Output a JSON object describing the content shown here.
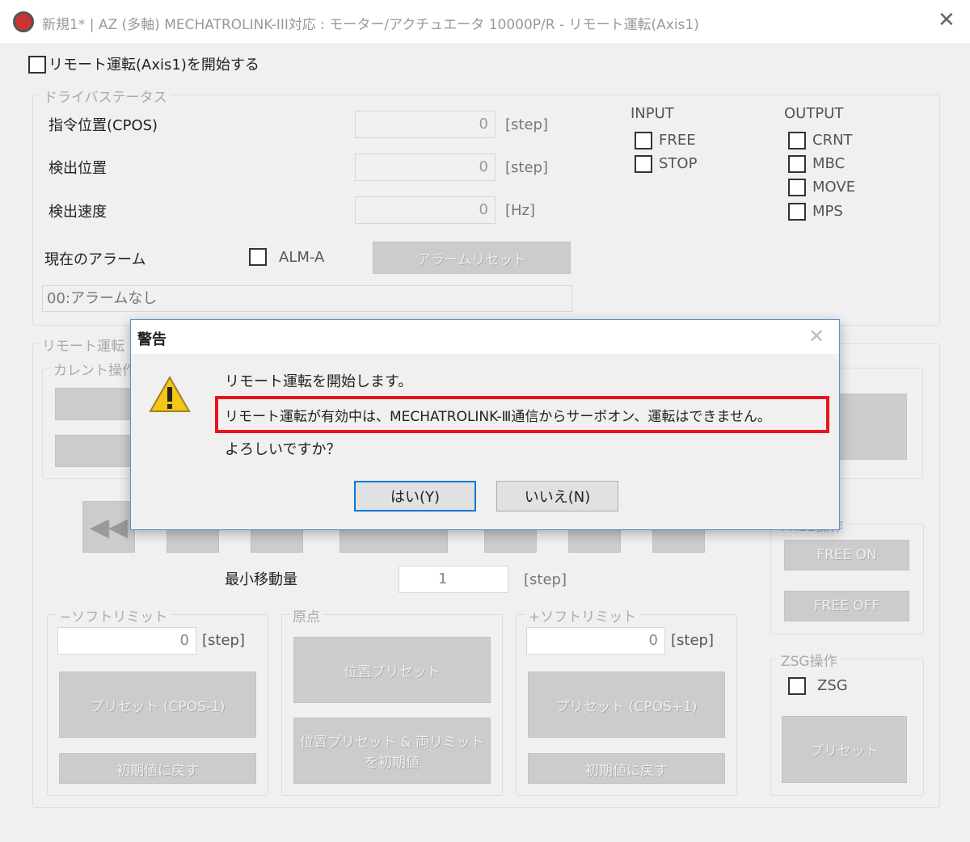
{
  "window": {
    "title": "新規1* | AZ (多軸) MECHATROLINK-III対応 : モーター/アクチュエータ 10000P/R - リモート運転(Axis1)",
    "close": "✕"
  },
  "remote_start_checkbox": "リモート運転(Axis1)を開始する",
  "driver_status": {
    "legend": "ドライバステータス",
    "rows": [
      {
        "label": "指令位置(CPOS)",
        "value": "0",
        "unit": "[step]"
      },
      {
        "label": "検出位置",
        "value": "0",
        "unit": "[step]"
      },
      {
        "label": "検出速度",
        "value": "0",
        "unit": "[Hz]"
      }
    ],
    "input_label": "INPUT",
    "inputs": [
      "FREE",
      "STOP"
    ],
    "output_label": "OUTPUT",
    "outputs": [
      "CRNT",
      "MBC",
      "MOVE",
      "MPS"
    ],
    "alarm_label": "現在のアラーム",
    "alarm_checkbox": "ALM-A",
    "alarm_reset": "アラームリセット",
    "alarm_text": "00:アラームなし"
  },
  "remote": {
    "legend": "リモート運転",
    "current_op": "カレント操作",
    "jog_icons": [
      "fast-reverse",
      "reverse",
      "stop",
      "stop-wide",
      "pause",
      "forward",
      "fast-forward"
    ],
    "min_move_label": "最小移動量",
    "min_move_value": "1",
    "min_move_unit": "[step]",
    "free_group": "FREE操作",
    "free_on": "FREE ON",
    "free_off": "FREE OFF",
    "zsg_group": "ZSG操作",
    "zsg_checkbox": "ZSG",
    "zsg_preset": "プリセット",
    "minus_limit": {
      "legend": "−ソフトリミット",
      "value": "0",
      "unit": "[step]",
      "preset": "プリセット (CPOS-1)",
      "reset": "初期値に戻す"
    },
    "origin": {
      "legend": "原点",
      "preset": "位置プリセット",
      "preset2": "位置プリセット & 両リミットを初期値"
    },
    "plus_limit": {
      "legend": "+ソフトリミット",
      "value": "0",
      "unit": "[step]",
      "preset": "プリセット (CPOS+1)",
      "reset": "初期値に戻す"
    }
  },
  "dialog": {
    "title": "警告",
    "line1": "リモート運転を開始します。",
    "line2": "リモート運転が有効中は、MECHATROLINK-Ⅲ通信からサーボオン、運転はできません。",
    "line3": "よろしいですか？",
    "yes": "はい(Y)",
    "no": "いいえ(N)",
    "highlight_color": "#e8141c"
  }
}
